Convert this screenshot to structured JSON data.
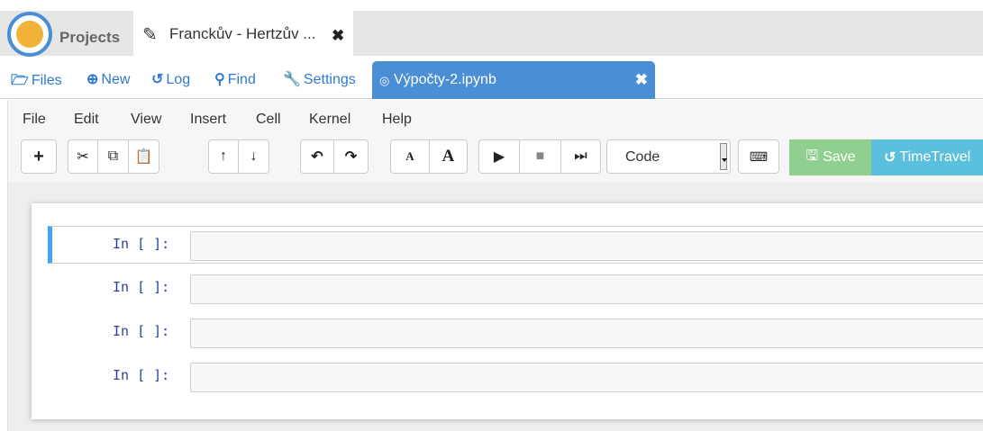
{
  "project_bar": {
    "projects_label": "Projects",
    "project_tab_title": "Franckův - Hertzův ..."
  },
  "file_tabs": {
    "files": "Files",
    "new": "New",
    "log": "Log",
    "find": "Find",
    "settings": "Settings",
    "notebook_tab": "Výpočty-2.ipynb"
  },
  "menu": [
    "File",
    "Edit",
    "View",
    "Insert",
    "Cell",
    "Kernel",
    "Help"
  ],
  "toolbar": {
    "cell_type": "Code",
    "save_label": "Save",
    "timetravel_label": "TimeTravel"
  },
  "cells": [
    {
      "prompt": "In [ ]:",
      "selected": true
    },
    {
      "prompt": "In [ ]:",
      "selected": false
    },
    {
      "prompt": "In [ ]:",
      "selected": false
    },
    {
      "prompt": "In [ ]:",
      "selected": false
    }
  ],
  "colors": {
    "accent": "#4a8fd6",
    "link": "#2f7ad1",
    "save": "#90cf8f",
    "timetravel": "#5bc0de",
    "prompt": "#303f9f",
    "selected_cell": "#42a5f5"
  },
  "icons": [
    "logo",
    "edit-icon",
    "close-icon",
    "folder-open-icon",
    "plus-circle-icon",
    "history-icon",
    "search-icon",
    "wrench-icon",
    "notebook-icon",
    "plus-icon",
    "cut-icon",
    "copy-icon",
    "paste-icon",
    "arrow-up-icon",
    "arrow-down-icon",
    "undo-icon",
    "redo-icon",
    "font-small-icon",
    "font-large-icon",
    "play-icon",
    "stop-icon",
    "step-icon",
    "keyboard-icon",
    "save-icon"
  ]
}
